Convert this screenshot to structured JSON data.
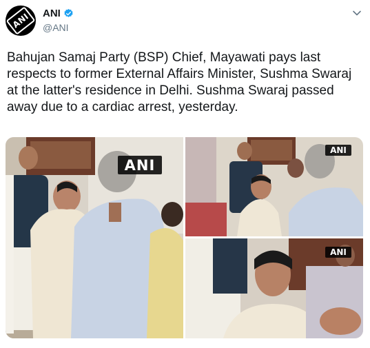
{
  "account": {
    "name": "ANI",
    "handle": "@ANI",
    "avatar_text": "ANI",
    "verified": true
  },
  "tweet": {
    "text": "Bahujan Samaj Party (BSP) Chief, Mayawati pays last respects to former External Affairs Minister, Sushma Swaraj at the latter's residence in Delhi. Sushma Swaraj passed away due to a cardiac arrest, yesterday."
  },
  "media": {
    "photos": [
      {
        "watermark": "ANI"
      },
      {
        "watermark": "ANI"
      },
      {
        "watermark": "ANI"
      }
    ]
  },
  "icons": {
    "verified": "verified-badge-icon",
    "menu": "chevron-down-icon"
  },
  "colors": {
    "verified": "#1da1f2",
    "handle": "#657786",
    "text": "#14171a"
  }
}
